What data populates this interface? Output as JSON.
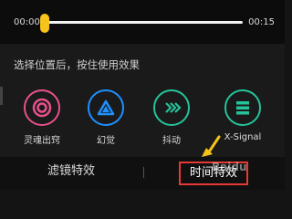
{
  "player": {
    "time_start": "00:00",
    "time_end": "00:15",
    "progress": 0.0
  },
  "hint": "选择位置后，按住使用效果",
  "effects": [
    {
      "label": "灵魂出窍",
      "color": "#e8508c",
      "icon": "target-rings-icon"
    },
    {
      "label": "幻觉",
      "color": "#1e90ff",
      "icon": "triangle-icon"
    },
    {
      "label": "抖动",
      "color": "#25c39a",
      "icon": "chevrons-icon"
    },
    {
      "label": "X-Signal",
      "color": "#25c39a",
      "icon": "stack-icon"
    }
  ],
  "tabs": {
    "filter": "滤镜特效",
    "time": "时间特效"
  },
  "watermark": "Baidu"
}
